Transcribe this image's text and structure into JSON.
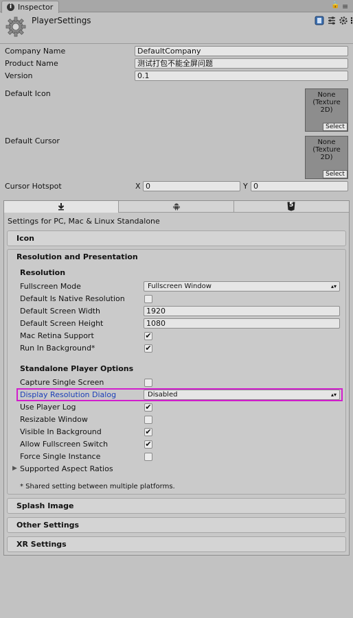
{
  "tab": {
    "label": "Inspector",
    "info_glyph": "i"
  },
  "window_controls": {
    "lock": "🔒",
    "menu": "≡"
  },
  "header": {
    "title": "PlayerSettings",
    "icons": [
      "help-icon",
      "preset-icon",
      "settings-gear-icon",
      "more-options-icon"
    ],
    "more_glyph": "⋮"
  },
  "fields": {
    "company_name": {
      "label": "Company Name",
      "value": "DefaultCompany"
    },
    "product_name": {
      "label": "Product Name",
      "value": "测试打包不能全屏问题"
    },
    "version": {
      "label": "Version",
      "value": "0.1"
    },
    "default_icon": {
      "label": "Default Icon",
      "slot_line1": "None",
      "slot_line2": "(Texture",
      "slot_line3": "2D)",
      "select_label": "Select"
    },
    "default_cursor": {
      "label": "Default Cursor",
      "slot_line1": "None",
      "slot_line2": "(Texture",
      "slot_line3": "2D)",
      "select_label": "Select"
    },
    "cursor_hotspot": {
      "label": "Cursor Hotspot",
      "x_label": "X",
      "x_value": "0",
      "y_label": "Y",
      "y_value": "0"
    }
  },
  "platform_tabs": [
    "standalone-tab",
    "android-tab",
    "webgl-html5-tab"
  ],
  "platform_tab_glyphs": {
    "html5": "5"
  },
  "settings_for": "Settings for PC, Mac & Linux Standalone",
  "sections": {
    "icon": "Icon",
    "resolution_presentation": "Resolution and Presentation",
    "splash_image": "Splash Image",
    "other_settings": "Other Settings",
    "xr_settings": "XR Settings"
  },
  "resolution": {
    "heading": "Resolution",
    "fullscreen_mode": {
      "label": "Fullscreen Mode",
      "value": "Fullscreen Window"
    },
    "default_native": {
      "label": "Default Is Native Resolution",
      "checked": false
    },
    "screen_width": {
      "label": "Default Screen Width",
      "value": "1920"
    },
    "screen_height": {
      "label": "Default Screen Height",
      "value": "1080"
    },
    "mac_retina": {
      "label": "Mac Retina Support",
      "checked": true
    },
    "run_in_background": {
      "label": "Run In Background*",
      "checked": true
    }
  },
  "standalone": {
    "heading": "Standalone Player Options",
    "capture_single_screen": {
      "label": "Capture Single Screen",
      "checked": false
    },
    "display_resolution_dialog": {
      "label": "Display Resolution Dialog",
      "value": "Disabled"
    },
    "use_player_log": {
      "label": "Use Player Log",
      "checked": true
    },
    "resizable_window": {
      "label": "Resizable Window",
      "checked": false
    },
    "visible_in_background": {
      "label": "Visible In Background",
      "checked": true
    },
    "allow_fullscreen_switch": {
      "label": "Allow Fullscreen Switch",
      "checked": true
    },
    "force_single_instance": {
      "label": "Force Single Instance",
      "checked": false
    },
    "supported_aspect_ratios": {
      "label": "Supported Aspect Ratios"
    }
  },
  "shared_note": "* Shared setting between multiple platforms.",
  "glyphs": {
    "check": "✔",
    "dropdown_arrows": "▴▾",
    "foldout_collapsed": "▶"
  },
  "colors": {
    "highlight": "#d21dcd",
    "link_label": "#1b3fb8"
  }
}
